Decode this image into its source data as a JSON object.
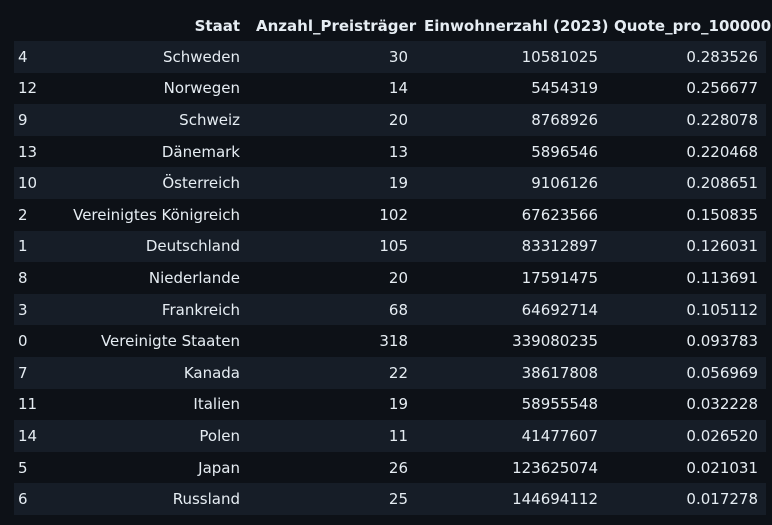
{
  "table": {
    "columns": [
      "",
      "Staat",
      "Anzahl_Preisträger",
      "Einwohnerzahl (2023)",
      "Quote_pro_100000"
    ],
    "rows": [
      [
        "4",
        "Schweden",
        "30",
        "10581025",
        "0.283526"
      ],
      [
        "12",
        "Norwegen",
        "14",
        "5454319",
        "0.256677"
      ],
      [
        "9",
        "Schweiz",
        "20",
        "8768926",
        "0.228078"
      ],
      [
        "13",
        "Dänemark",
        "13",
        "5896546",
        "0.220468"
      ],
      [
        "10",
        "Österreich",
        "19",
        "9106126",
        "0.208651"
      ],
      [
        "2",
        "Vereinigtes Königreich",
        "102",
        "67623566",
        "0.150835"
      ],
      [
        "1",
        "Deutschland",
        "105",
        "83312897",
        "0.126031"
      ],
      [
        "8",
        "Niederlande",
        "20",
        "17591475",
        "0.113691"
      ],
      [
        "3",
        "Frankreich",
        "68",
        "64692714",
        "0.105112"
      ],
      [
        "0",
        "Vereinigte Staaten",
        "318",
        "339080235",
        "0.093783"
      ],
      [
        "7",
        "Kanada",
        "22",
        "38617808",
        "0.056969"
      ],
      [
        "11",
        "Italien",
        "19",
        "58955548",
        "0.032228"
      ],
      [
        "14",
        "Polen",
        "11",
        "41477607",
        "0.026520"
      ],
      [
        "5",
        "Japan",
        "26",
        "123625074",
        "0.021031"
      ],
      [
        "6",
        "Russland",
        "25",
        "144694112",
        "0.017278"
      ]
    ]
  },
  "colors": {
    "background": "#0d1117",
    "row_stripe": "#161d27",
    "text": "#e6edf3"
  }
}
